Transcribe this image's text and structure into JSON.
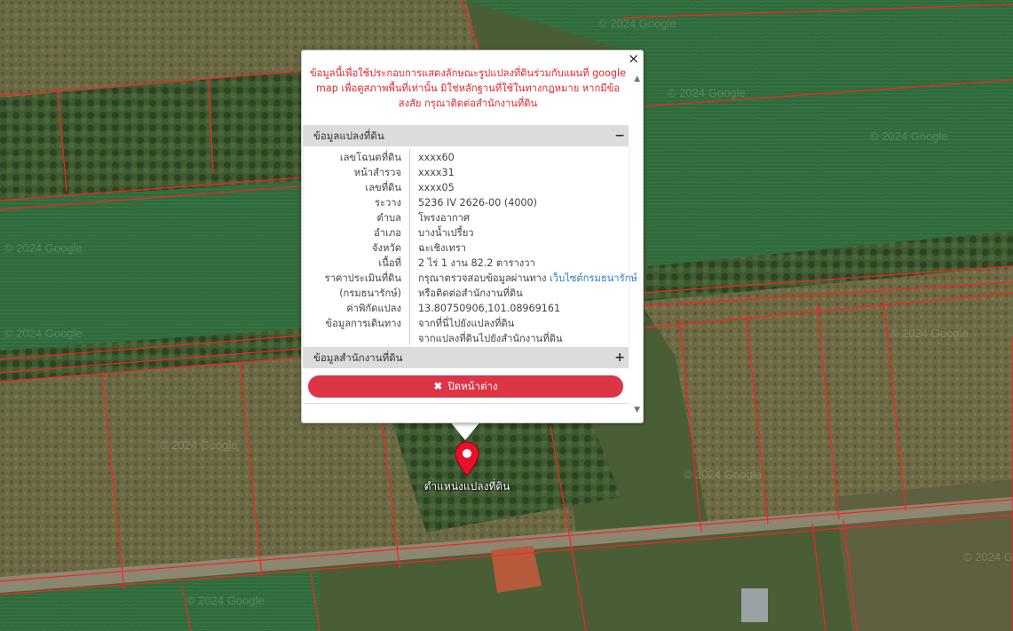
{
  "map": {
    "watermark": "© 2024 Google",
    "marker_label": "ตำแหน่งแปลงที่ดิน"
  },
  "popup": {
    "close_icon": "×",
    "notice": "ข้อมูลนี้เพื่อใช้ประกอบการแสดงลักษณะรูปแปลงที่ดินร่วมกับแผนที่ google map เพื่อดูสภาพพื้นที่เท่านั้น มิใช่หลักฐานที่ใช้ในทางกฎหมาย หากมีข้อสงสัย กรุณาติดต่อสำนักงานที่ดิน",
    "panel1": {
      "title": "ข้อมูลแปลงที่ดิน",
      "toggle": "−"
    },
    "panel2": {
      "title": "ข้อมูลสำนักงานที่ดิน",
      "toggle": "+"
    },
    "rows": {
      "deed_no": {
        "label": "เลขโฉนดที่ดิน",
        "value": "xxxx60"
      },
      "survey_page": {
        "label": "หน้าสำรวจ",
        "value": "xxxx31"
      },
      "land_no": {
        "label": "เลขที่ดิน",
        "value": "xxxx05"
      },
      "sheet": {
        "label": "ระวาง",
        "value": "5236 IV 2626-00 (4000)"
      },
      "subdistrict": {
        "label": "ตำบล",
        "value": "โพรงอากาศ"
      },
      "district": {
        "label": "อำเภอ",
        "value": "บางน้ำเปรี้ยว"
      },
      "province": {
        "label": "จังหวัด",
        "value": "ฉะเชิงเทรา"
      },
      "area": {
        "label": "เนื้อที่",
        "value": "2 ไร่ 1 งาน 82.2 ตารางวา"
      },
      "appraisal": {
        "label1": "ราคาประเมินที่ดิน",
        "label2": "(กรมธนารักษ์)",
        "value_prefix": "กรุณาตรวจสอบข้อมูลผ่านทาง ",
        "value_link": "เว็บไซต์กรมธนารักษ์",
        "value2": "หรือติดต่อสำนักงานที่ดิน"
      },
      "coords": {
        "label": "ค่าพิกัดแปลง",
        "value": "13.80750906,101.08969161"
      },
      "travel": {
        "label": "ข้อมูลการเดินทาง",
        "link1": "จากที่นี่ไปยังแปลงที่ดิน",
        "link2": "จากแปลงที่ดินไปยังสำนักงานที่ดิน"
      }
    },
    "close_button": {
      "icon": "✖",
      "label": "ปิดหน้าต่าง"
    }
  },
  "colors": {
    "notice": "#e0262f",
    "button": "#dc3545",
    "link": "#2a7bd6",
    "parcel_line": "#ff2020",
    "marker": "#e8102a"
  }
}
